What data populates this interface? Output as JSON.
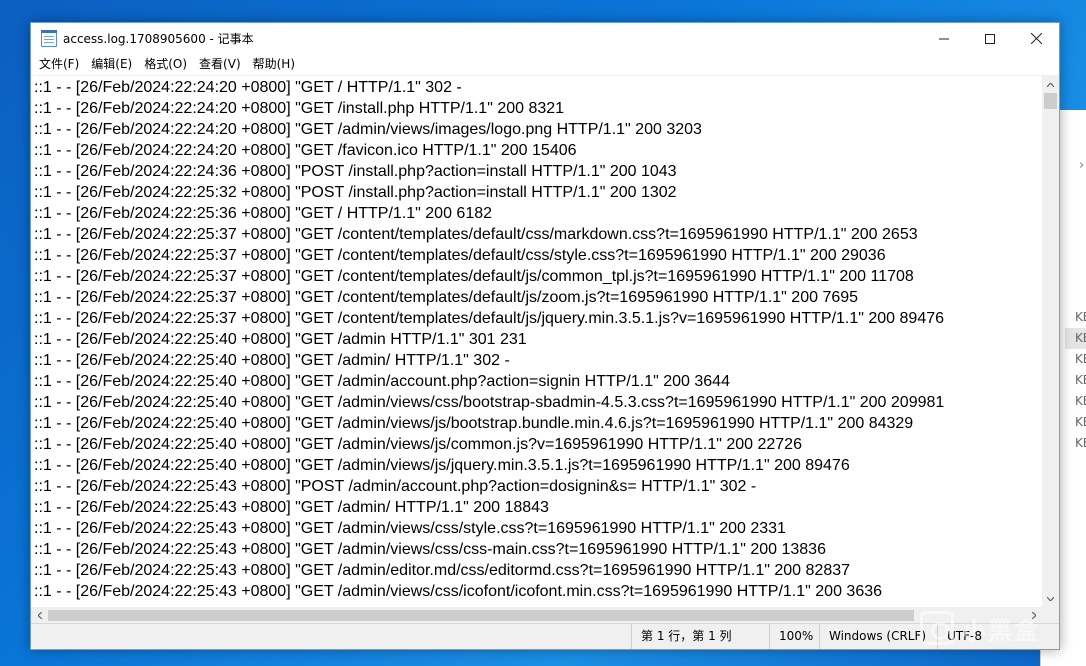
{
  "window": {
    "title": "access.log.1708905600 - 记事本",
    "minimize_icon": "minimize-icon",
    "maximize_icon": "maximize-icon",
    "close_icon": "close-icon"
  },
  "menu": [
    "文件(F)",
    "编辑(E)",
    "格式(O)",
    "查看(V)",
    "帮助(H)"
  ],
  "lines": [
    "::1 - - [26/Feb/2024:22:24:20 +0800] \"GET / HTTP/1.1\" 302 -",
    "::1 - - [26/Feb/2024:22:24:20 +0800] \"GET /install.php HTTP/1.1\" 200 8321",
    "::1 - - [26/Feb/2024:22:24:20 +0800] \"GET /admin/views/images/logo.png HTTP/1.1\" 200 3203",
    "::1 - - [26/Feb/2024:22:24:20 +0800] \"GET /favicon.ico HTTP/1.1\" 200 15406",
    "::1 - - [26/Feb/2024:22:24:36 +0800] \"POST /install.php?action=install HTTP/1.1\" 200 1043",
    "::1 - - [26/Feb/2024:22:25:32 +0800] \"POST /install.php?action=install HTTP/1.1\" 200 1302",
    "::1 - - [26/Feb/2024:22:25:36 +0800] \"GET / HTTP/1.1\" 200 6182",
    "::1 - - [26/Feb/2024:22:25:37 +0800] \"GET /content/templates/default/css/markdown.css?t=1695961990 HTTP/1.1\" 200 2653",
    "::1 - - [26/Feb/2024:22:25:37 +0800] \"GET /content/templates/default/css/style.css?t=1695961990 HTTP/1.1\" 200 29036",
    "::1 - - [26/Feb/2024:22:25:37 +0800] \"GET /content/templates/default/js/common_tpl.js?t=1695961990 HTTP/1.1\" 200 11708",
    "::1 - - [26/Feb/2024:22:25:37 +0800] \"GET /content/templates/default/js/zoom.js?t=1695961990 HTTP/1.1\" 200 7695",
    "::1 - - [26/Feb/2024:22:25:37 +0800] \"GET /content/templates/default/js/jquery.min.3.5.1.js?v=1695961990 HTTP/1.1\" 200 89476",
    "::1 - - [26/Feb/2024:22:25:40 +0800] \"GET /admin HTTP/1.1\" 301 231",
    "::1 - - [26/Feb/2024:22:25:40 +0800] \"GET /admin/ HTTP/1.1\" 302 -",
    "::1 - - [26/Feb/2024:22:25:40 +0800] \"GET /admin/account.php?action=signin HTTP/1.1\" 200 3644",
    "::1 - - [26/Feb/2024:22:25:40 +0800] \"GET /admin/views/css/bootstrap-sbadmin-4.5.3.css?t=1695961990 HTTP/1.1\" 200 209981",
    "::1 - - [26/Feb/2024:22:25:40 +0800] \"GET /admin/views/js/bootstrap.bundle.min.4.6.js?t=1695961990 HTTP/1.1\" 200 84329",
    "::1 - - [26/Feb/2024:22:25:40 +0800] \"GET /admin/views/js/common.js?v=1695961990 HTTP/1.1\" 200 22726",
    "::1 - - [26/Feb/2024:22:25:40 +0800] \"GET /admin/views/js/jquery.min.3.5.1.js?t=1695961990 HTTP/1.1\" 200 89476",
    "::1 - - [26/Feb/2024:22:25:43 +0800] \"POST /admin/account.php?action=dosignin&s= HTTP/1.1\" 302 -",
    "::1 - - [26/Feb/2024:22:25:43 +0800] \"GET /admin/ HTTP/1.1\" 200 18843",
    "::1 - - [26/Feb/2024:22:25:43 +0800] \"GET /admin/views/css/style.css?t=1695961990 HTTP/1.1\" 200 2331",
    "::1 - - [26/Feb/2024:22:25:43 +0800] \"GET /admin/views/css/css-main.css?t=1695961990 HTTP/1.1\" 200 13836",
    "::1 - - [26/Feb/2024:22:25:43 +0800] \"GET /admin/editor.md/css/editormd.css?t=1695961990 HTTP/1.1\" 200 82837",
    "::1 - - [26/Feb/2024:22:25:43 +0800] \"GET /admin/views/css/icofont/icofont.min.css?t=1695961990 HTTP/1.1\" 200 3636"
  ],
  "status": {
    "position": "第 1 行，第 1 列",
    "zoom": "100%",
    "line_ending": "Windows (CRLF)",
    "encoding": "UTF-8"
  },
  "background_window": {
    "sizes": [
      "KB",
      "KB",
      "KB",
      "KB",
      "KB",
      "KB",
      "KB"
    ],
    "chevron": "›"
  },
  "watermark": {
    "text": "小黑盒"
  }
}
